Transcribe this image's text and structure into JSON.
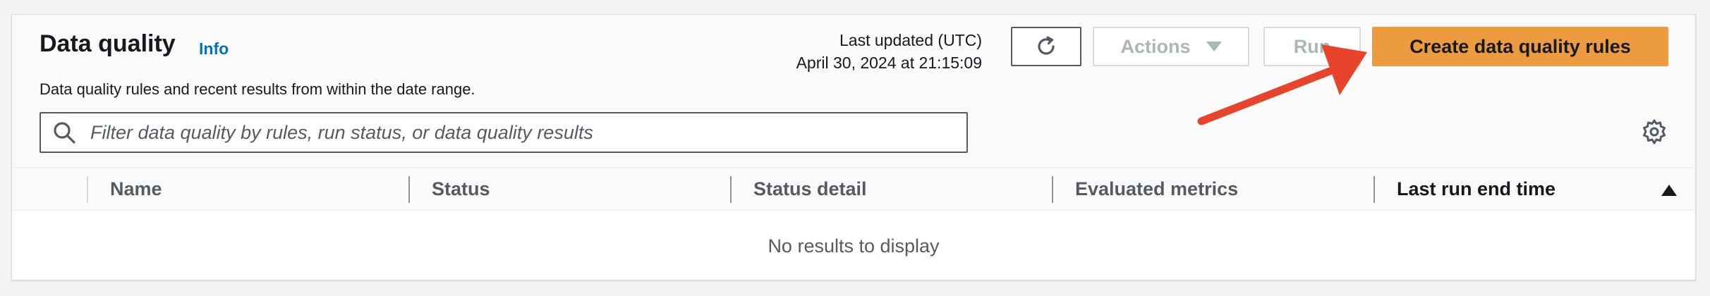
{
  "section": {
    "title": "Data quality",
    "info_link": "Info",
    "description": "Data quality rules and recent results from within the date range."
  },
  "last_updated": {
    "label": "Last updated (UTC)",
    "value": "April 30, 2024 at 21:15:09"
  },
  "toolbar": {
    "refresh_icon": "refresh-icon",
    "actions_label": "Actions",
    "run_label": "Run",
    "create_label": "Create data quality rules"
  },
  "search": {
    "placeholder": "Filter data quality by rules, run status, or data quality results",
    "value": ""
  },
  "table": {
    "columns": [
      "Name",
      "Status",
      "Status detail",
      "Evaluated metrics",
      "Last run end time"
    ],
    "sorted_column": "Last run end time",
    "sort_direction": "ascending",
    "empty_message": "No results to display",
    "rows": []
  },
  "colors": {
    "primary_button": "#ec9c3e",
    "link": "#0073bb",
    "annotation_arrow": "#e8442b"
  }
}
